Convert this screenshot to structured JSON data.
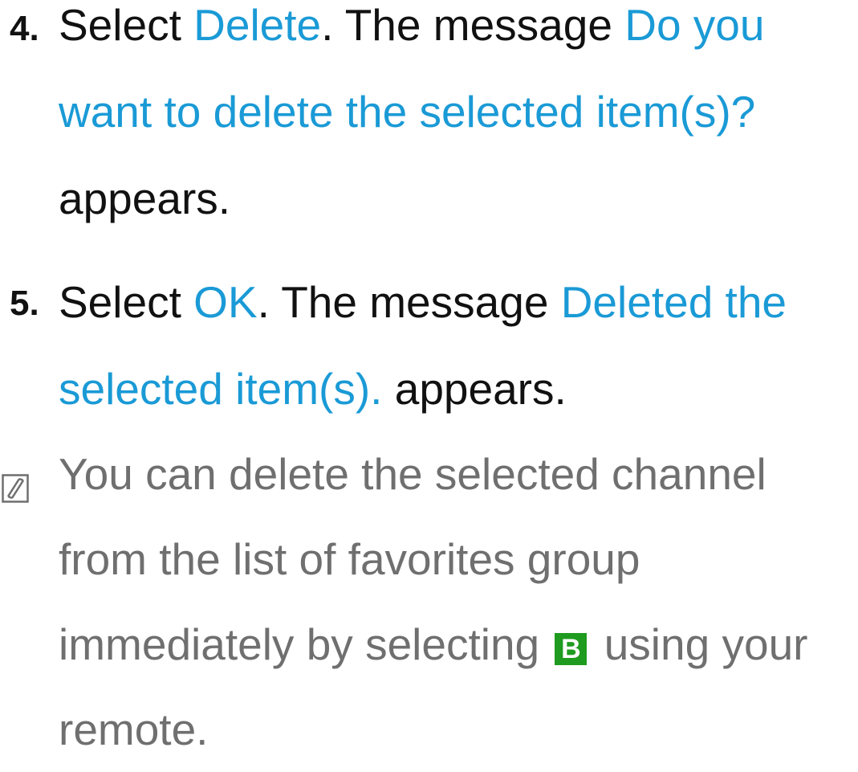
{
  "steps": [
    {
      "number": "4.",
      "parts": {
        "t1": "Select ",
        "h1": "Delete",
        "t2": ". The message ",
        "h2": "Do you want to delete the selected item(s)?",
        "t3": " appears."
      }
    },
    {
      "number": "5.",
      "parts": {
        "t1": "Select ",
        "h1": "OK",
        "t2": ". The message ",
        "h2": "Deleted the selected item(s).",
        "t3": " appears."
      }
    }
  ],
  "note": {
    "icon": "note-icon",
    "text_before": "You can delete the selected channel from the list of favorites group immediately by selecting ",
    "button_label": "B",
    "button_color": "#1f9b1f",
    "text_after": " using your remote."
  },
  "colors": {
    "highlight": "#1a9ad6",
    "body_text": "#111111",
    "note_text": "#6f6f6f"
  }
}
